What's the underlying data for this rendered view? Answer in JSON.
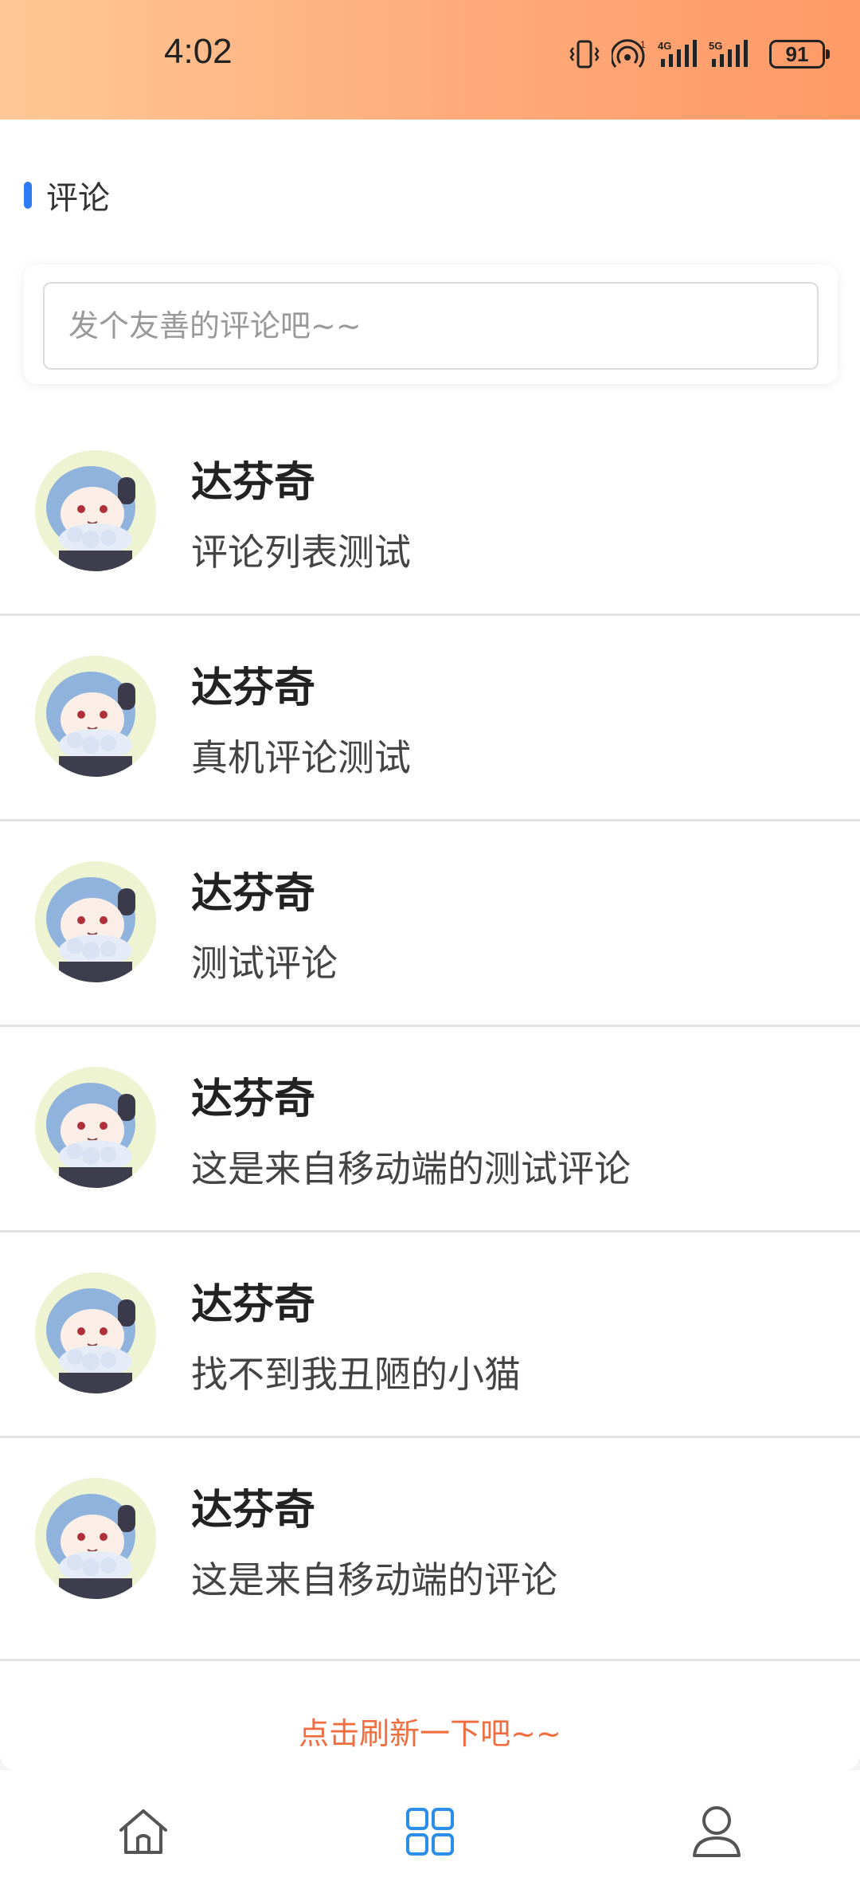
{
  "status_bar": {
    "time": "4:02",
    "battery": "91",
    "icons": [
      "vibrate-icon",
      "hotspot-icon",
      "signal-4g-icon",
      "signal-5g-icon",
      "battery-icon"
    ]
  },
  "section": {
    "title": "评论",
    "accent_color": "#2f7bf6"
  },
  "comment_input": {
    "placeholder": "发个友善的评论吧~~"
  },
  "comments": [
    {
      "name": "达芬奇",
      "text": "评论列表测试"
    },
    {
      "name": "达芬奇",
      "text": "真机评论测试"
    },
    {
      "name": "达芬奇",
      "text": "测试评论"
    },
    {
      "name": "达芬奇",
      "text": "这是来自移动端的测试评论"
    },
    {
      "name": "达芬奇",
      "text": "找不到我丑陋的小猫"
    },
    {
      "name": "达芬奇",
      "text": "这是来自移动端的评论"
    }
  ],
  "refresh": {
    "label": "点击刷新一下吧~~",
    "color": "#f06d3f"
  },
  "tab_bar": {
    "tabs": [
      {
        "icon": "home-icon",
        "active": false
      },
      {
        "icon": "grid-icon",
        "active": true
      },
      {
        "icon": "user-icon",
        "active": false
      }
    ],
    "active_color": "#2b8ee8",
    "inactive_color": "#555555"
  }
}
